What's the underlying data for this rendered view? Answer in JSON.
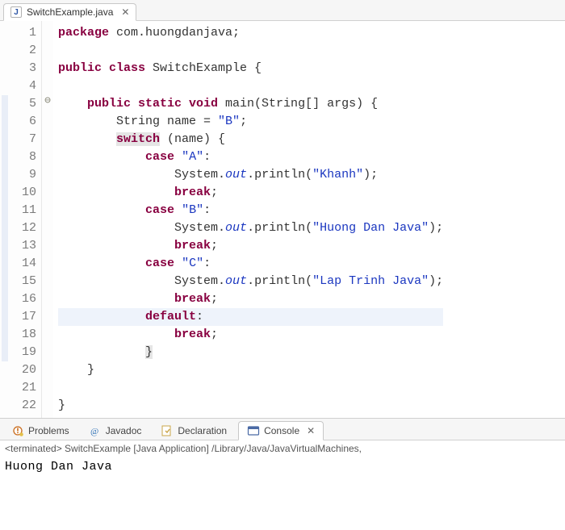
{
  "editor": {
    "tab": {
      "label": "SwitchExample.java",
      "close": "✕"
    },
    "lines": {
      "1": {
        "n": "1",
        "pre": "",
        "seg": [
          [
            "kw",
            "package"
          ],
          [
            "punct",
            " com.huongdanjava;"
          ]
        ]
      },
      "2": {
        "n": "2",
        "pre": "",
        "seg": []
      },
      "3": {
        "n": "3",
        "pre": "",
        "seg": [
          [
            "kw",
            "public class"
          ],
          [
            "punct",
            " SwitchExample {"
          ]
        ]
      },
      "4": {
        "n": "4",
        "pre": "",
        "seg": []
      },
      "5": {
        "n": "5",
        "pre": "    ",
        "seg": [
          [
            "kw",
            "public static void"
          ],
          [
            "punct",
            " main(String[] args) {"
          ]
        ],
        "fold": true,
        "ruler": true
      },
      "6": {
        "n": "6",
        "pre": "        ",
        "seg": [
          [
            "punct",
            "String name = "
          ],
          [
            "str",
            "\"B\""
          ],
          [
            "punct",
            ";"
          ]
        ],
        "ruler": true
      },
      "7": {
        "n": "7",
        "pre": "        ",
        "seg": [
          [
            "kw-hl",
            "switch"
          ],
          [
            "punct",
            " (name) {"
          ]
        ],
        "ruler": true
      },
      "8": {
        "n": "8",
        "pre": "            ",
        "seg": [
          [
            "kw",
            "case"
          ],
          [
            "punct",
            " "
          ],
          [
            "str",
            "\"A\""
          ],
          [
            "punct",
            ":"
          ]
        ],
        "ruler": true
      },
      "9": {
        "n": "9",
        "pre": "                ",
        "seg": [
          [
            "punct",
            "System."
          ],
          [
            "field",
            "out"
          ],
          [
            "punct",
            ".println("
          ],
          [
            "str",
            "\"Khanh\""
          ],
          [
            "punct",
            ");"
          ]
        ],
        "ruler": true
      },
      "10": {
        "n": "10",
        "pre": "                ",
        "seg": [
          [
            "kw",
            "break"
          ],
          [
            "punct",
            ";"
          ]
        ],
        "ruler": true
      },
      "11": {
        "n": "11",
        "pre": "            ",
        "seg": [
          [
            "kw",
            "case"
          ],
          [
            "punct",
            " "
          ],
          [
            "str",
            "\"B\""
          ],
          [
            "punct",
            ":"
          ]
        ],
        "ruler": true
      },
      "12": {
        "n": "12",
        "pre": "                ",
        "seg": [
          [
            "punct",
            "System."
          ],
          [
            "field",
            "out"
          ],
          [
            "punct",
            ".println("
          ],
          [
            "str",
            "\"Huong Dan Java\""
          ],
          [
            "punct",
            ");"
          ]
        ],
        "ruler": true
      },
      "13": {
        "n": "13",
        "pre": "                ",
        "seg": [
          [
            "kw",
            "break"
          ],
          [
            "punct",
            ";"
          ]
        ],
        "ruler": true
      },
      "14": {
        "n": "14",
        "pre": "            ",
        "seg": [
          [
            "kw",
            "case"
          ],
          [
            "punct",
            " "
          ],
          [
            "str",
            "\"C\""
          ],
          [
            "punct",
            ":"
          ]
        ],
        "ruler": true
      },
      "15": {
        "n": "15",
        "pre": "                ",
        "seg": [
          [
            "punct",
            "System."
          ],
          [
            "field",
            "out"
          ],
          [
            "punct",
            ".println("
          ],
          [
            "str",
            "\"Lap Trinh Java\""
          ],
          [
            "punct",
            ");"
          ]
        ],
        "ruler": true
      },
      "16": {
        "n": "16",
        "pre": "                ",
        "seg": [
          [
            "kw",
            "break"
          ],
          [
            "punct",
            ";"
          ]
        ],
        "ruler": true
      },
      "17": {
        "n": "17",
        "pre": "            ",
        "seg": [
          [
            "kw",
            "default"
          ],
          [
            "punct",
            ":"
          ]
        ],
        "hl": true,
        "ruler": true
      },
      "18": {
        "n": "18",
        "pre": "                ",
        "seg": [
          [
            "kw",
            "break"
          ],
          [
            "punct",
            ";"
          ]
        ],
        "ruler": true
      },
      "19": {
        "n": "19",
        "pre": "            ",
        "seg": [
          [
            "punct-hl",
            "}"
          ]
        ],
        "ruler": true
      },
      "20": {
        "n": "20",
        "pre": "    ",
        "seg": [
          [
            "punct",
            "}"
          ]
        ]
      },
      "21": {
        "n": "21",
        "pre": "",
        "seg": []
      },
      "22": {
        "n": "22",
        "pre": "",
        "seg": [
          [
            "punct",
            "}"
          ]
        ]
      }
    }
  },
  "bottom": {
    "tabs": {
      "problems": "Problems",
      "javadoc": "Javadoc",
      "declaration": "Declaration",
      "console": "Console",
      "close": "✕"
    }
  },
  "console": {
    "status": "<terminated> SwitchExample [Java Application] /Library/Java/JavaVirtualMachines,",
    "output": "Huong Dan Java"
  }
}
